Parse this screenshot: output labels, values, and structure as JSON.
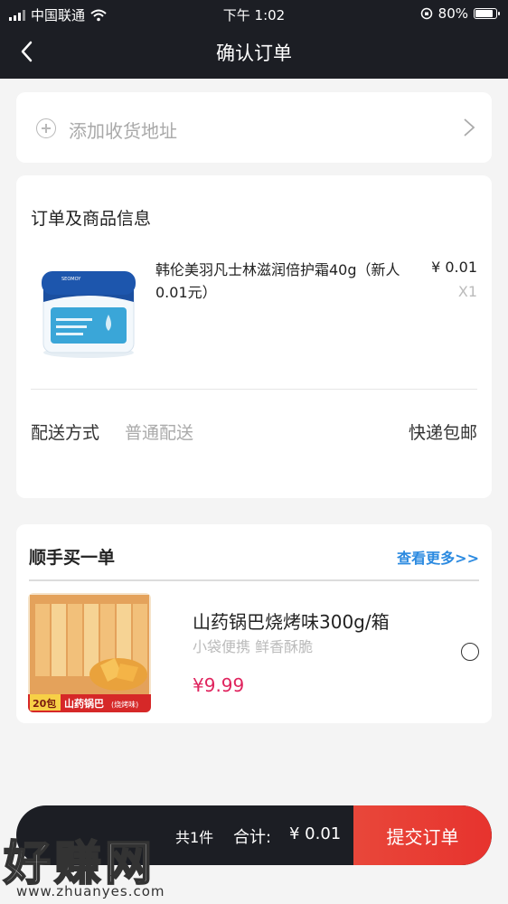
{
  "status_bar": {
    "carrier": "中国联通",
    "time": "下午 1:02",
    "battery": "80%"
  },
  "nav": {
    "title": "确认订单"
  },
  "address": {
    "placeholder": "添加收货地址"
  },
  "order": {
    "section_title": "订单及商品信息",
    "product": {
      "name": "韩伦美羽凡士林滋润倍护霜40g（新人0.01元）",
      "price": "¥ 0.01",
      "qty": "X1",
      "image_label": "SEOMOY"
    },
    "shipping_label": "配送方式",
    "shipping_value": "普通配送",
    "shipping_right": "快递包邮"
  },
  "recommend": {
    "section_title": "顺手买一单",
    "more": "查看更多>>",
    "item": {
      "name": "山药锅巴烧烤味300g/箱",
      "sub": "小袋便携 鲜香酥脆",
      "price": "¥9.99",
      "badge": "20包",
      "label": "山药锅巴",
      "flavor": "(烧烤味)"
    }
  },
  "bottom": {
    "count": "共1件",
    "total_label": "合计:",
    "total": "¥ 0.01",
    "submit": "提交订单"
  },
  "watermark": {
    "big": "好赚网",
    "small": "www.zhuanyes.com"
  },
  "colors": {
    "nav_bg": "#1c1e24",
    "accent_red": "#e8473a",
    "price_pink": "#e0245e",
    "link_blue": "#2b8ae0"
  }
}
